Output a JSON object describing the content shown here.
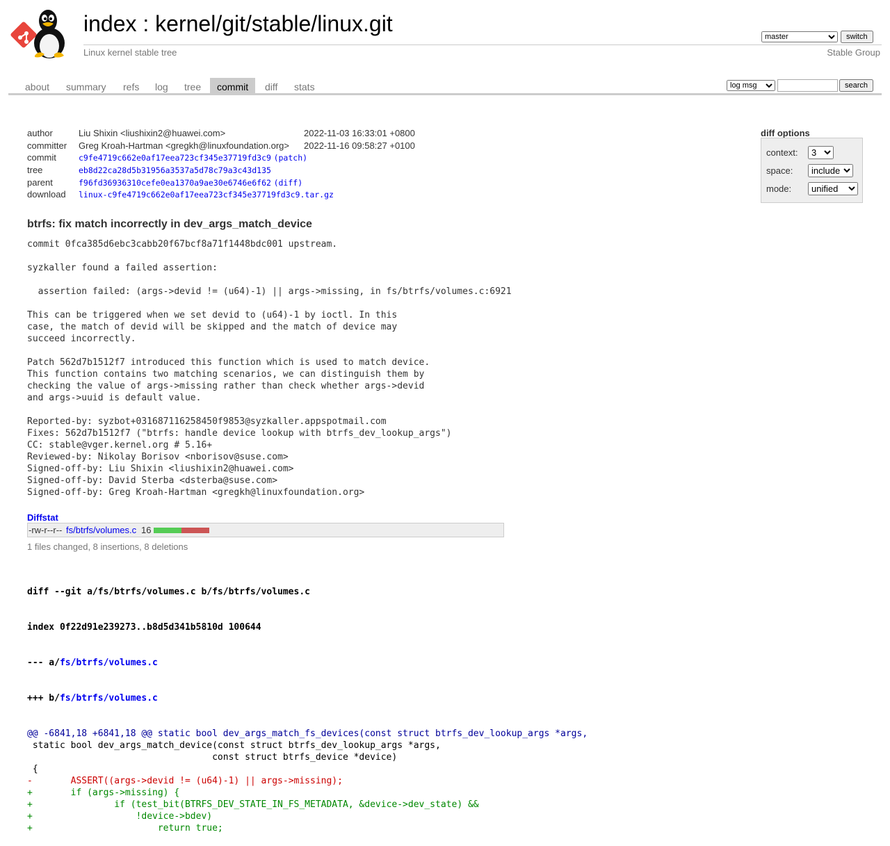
{
  "header": {
    "title_index": "index",
    "title_sep": " : ",
    "title_repo": "kernel/git/stable/linux.git",
    "subtitle": "Linux kernel stable tree",
    "owner": "Stable Group",
    "branch": "master",
    "switch_label": "switch"
  },
  "tabs": [
    {
      "label": "about"
    },
    {
      "label": "summary"
    },
    {
      "label": "refs"
    },
    {
      "label": "log"
    },
    {
      "label": "tree"
    },
    {
      "label": "commit",
      "active": true
    },
    {
      "label": "diff"
    },
    {
      "label": "stats"
    }
  ],
  "search": {
    "mode": "log msg",
    "value": "",
    "button_label": "search"
  },
  "commit_info": {
    "author_label": "author",
    "author": "Liu Shixin <liushixin2@huawei.com>",
    "author_date": "2022-11-03 16:33:01 +0800",
    "committer_label": "committer",
    "committer": "Greg Kroah-Hartman <gregkh@linuxfoundation.org>",
    "committer_date": "2022-11-16 09:58:27 +0100",
    "commit_label": "commit",
    "commit": "c9fe4719c662e0af17eea723cf345e37719fd3c9",
    "commit_extra": "(patch)",
    "tree_label": "tree",
    "tree": "eb8d22ca28d5b31956a3537a5d78c79a3c43d135",
    "parent_label": "parent",
    "parent": "f96fd36936310cefe0ea1370a9ae30e6746e6f62",
    "parent_extra": "(diff)",
    "download_label": "download",
    "download": "linux-c9fe4719c662e0af17eea723cf345e37719fd3c9.tar.gz"
  },
  "diff_options": {
    "title": "diff options",
    "context_label": "context:",
    "context_value": "3",
    "space_label": "space:",
    "space_value": "include",
    "mode_label": "mode:",
    "mode_value": "unified"
  },
  "commit_subject": "btrfs: fix match incorrectly in dev_args_match_device",
  "commit_message": "commit 0fca385d6ebc3cabb20f67bcf8a71f1448bdc001 upstream.\n\nsyzkaller found a failed assertion:\n\n  assertion failed: (args->devid != (u64)-1) || args->missing, in fs/btrfs/volumes.c:6921\n\nThis can be triggered when we set devid to (u64)-1 by ioctl. In this\ncase, the match of devid will be skipped and the match of device may\nsucceed incorrectly.\n\nPatch 562d7b1512f7 introduced this function which is used to match device.\nThis function contains two matching scenarios, we can distinguish them by\nchecking the value of args->missing rather than check whether args->devid\nand args->uuid is default value.\n\nReported-by: syzbot+031687116258450f9853@syzkaller.appspotmail.com\nFixes: 562d7b1512f7 (\"btrfs: handle device lookup with btrfs_dev_lookup_args\")\nCC: stable@vger.kernel.org # 5.16+\nReviewed-by: Nikolay Borisov <nborisov@suse.com>\nSigned-off-by: Liu Shixin <liushixin2@huawei.com>\nSigned-off-by: David Sterba <dsterba@suse.com>\nSigned-off-by: Greg Kroah-Hartman <gregkh@linuxfoundation.org>",
  "diffstat": {
    "header": "Diffstat",
    "mode": "-rw-r--r--",
    "file": "fs/btrfs/volumes.c",
    "count": "16",
    "insertions": 8,
    "deletions": 8,
    "summary": "1 files changed, 8 insertions, 8 deletions",
    "add_color": "#55cc55",
    "del_color": "#cc5555"
  },
  "diff": {
    "git_line": "diff --git a/fs/btrfs/volumes.c b/fs/btrfs/volumes.c",
    "index_line": "index 0f22d91e239273..b8d5d341b5810d 100644",
    "old_prefix": "--- a/",
    "old_file": "fs/btrfs/volumes.c",
    "new_prefix": "+++ b/",
    "new_file": "fs/btrfs/volumes.c",
    "lines": [
      {
        "type": "hunk",
        "text": "@@ -6841,18 +6841,18 @@ static bool dev_args_match_fs_devices(const struct btrfs_dev_lookup_args *args,"
      },
      {
        "type": "ctx",
        "text": " static bool dev_args_match_device(const struct btrfs_dev_lookup_args *args,"
      },
      {
        "type": "ctx",
        "text": " \t\t\t\t  const struct btrfs_device *device)"
      },
      {
        "type": "ctx",
        "text": " {"
      },
      {
        "type": "del",
        "text": "-\tASSERT((args->devid != (u64)-1) || args->missing);"
      },
      {
        "type": "add",
        "text": "+\tif (args->missing) {"
      },
      {
        "type": "add",
        "text": "+\t\tif (test_bit(BTRFS_DEV_STATE_IN_FS_METADATA, &device->dev_state) &&"
      },
      {
        "type": "add",
        "text": "+\t\t    !device->bdev)"
      },
      {
        "type": "add",
        "text": "+\t\t\treturn true;"
      }
    ]
  },
  "colors": {
    "link": "#0000ee",
    "active_tab_bg": "#cccccc",
    "diff_del": "#cc0000",
    "diff_add": "#008800",
    "diff_hunk": "#000099"
  }
}
